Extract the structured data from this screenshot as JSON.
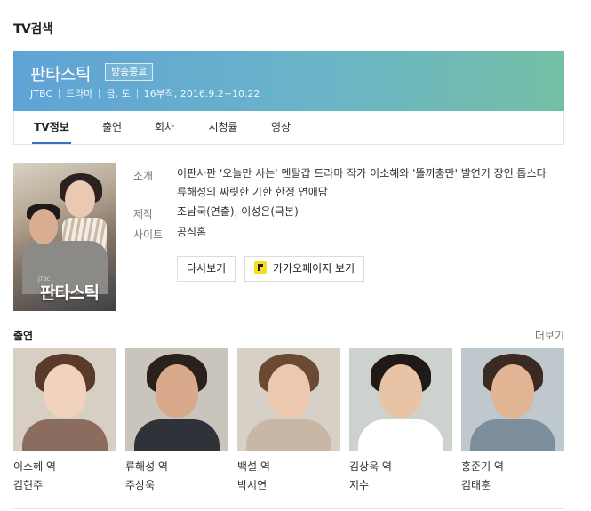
{
  "section": {
    "title": "TV검색"
  },
  "program": {
    "title": "판타스틱",
    "status_badge": "방송종료",
    "meta": [
      "JTBC",
      "드라마",
      "금, 토",
      "16부작, 2016.9.2~10.22"
    ]
  },
  "tabs": [
    {
      "label": "TV정보",
      "active": true
    },
    {
      "label": "출연",
      "active": false
    },
    {
      "label": "회차",
      "active": false
    },
    {
      "label": "시청률",
      "active": false
    },
    {
      "label": "영상",
      "active": false
    }
  ],
  "poster": {
    "title": "판타스틱",
    "logo": "JTBC"
  },
  "info": {
    "intro_label": "소개",
    "intro_text": "이판사판 '오늘만 사는' 멘탈갑 드라마 작가 이소혜와 '똘끼충만' 발연기 장인 톱스타 류해성의 짜릿한 기한 한정 연애담",
    "staff_label": "제작",
    "staff_director": "조남국",
    "staff_director_role": "(연출)",
    "staff_sep": ",",
    "staff_writer": "이성은",
    "staff_writer_role": "(극본)",
    "site_label": "사이트",
    "site_link": "공식홈"
  },
  "buttons": {
    "replay": "다시보기",
    "kakao": "카카오페이지 보기"
  },
  "cast_section": {
    "title": "출연",
    "more": "더보기"
  },
  "cast": [
    {
      "role": "이소혜 역",
      "actor": "김현주",
      "bg": "#d8cfc4",
      "face": "#f0d2bd",
      "hair": "#5a3a2a",
      "body": "#8a6d5e"
    },
    {
      "role": "류해성 역",
      "actor": "주상욱",
      "bg": "#c9c4bc",
      "face": "#d8a98a",
      "hair": "#2a201c",
      "body": "#2f3238"
    },
    {
      "role": "백설 역",
      "actor": "박시연",
      "bg": "#d6d0c6",
      "face": "#ecc8b0",
      "hair": "#6b4a34",
      "body": "#c9b7a6"
    },
    {
      "role": "김상욱 역",
      "actor": "지수",
      "bg": "#cdd2cf",
      "face": "#e8c3a6",
      "hair": "#1f1a18",
      "body": "#ffffff"
    },
    {
      "role": "홍준기 역",
      "actor": "김태훈",
      "bg": "#bfc8cd",
      "face": "#e1b494",
      "hair": "#3a2a22",
      "body": "#7c8e9c"
    }
  ]
}
